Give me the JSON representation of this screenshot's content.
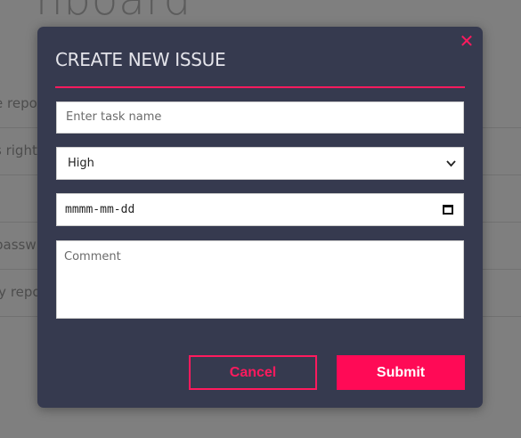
{
  "background": {
    "title": "hboard",
    "rows": [
      "e repo",
      "s right",
      "",
      "passw",
      "ly repo"
    ]
  },
  "modal": {
    "title": "CREATE NEW ISSUE",
    "close_icon": "close-icon",
    "task_placeholder": "Enter task name",
    "priority_value": "High",
    "date_placeholder": "mmmm-mm-dd",
    "comment_placeholder": "Comment",
    "cancel_label": "Cancel",
    "submit_label": "Submit"
  },
  "colors": {
    "accent": "#ff1a5e",
    "modal_bg": "#363a4f",
    "overlay": "rgba(0,0,0,0.5)"
  }
}
